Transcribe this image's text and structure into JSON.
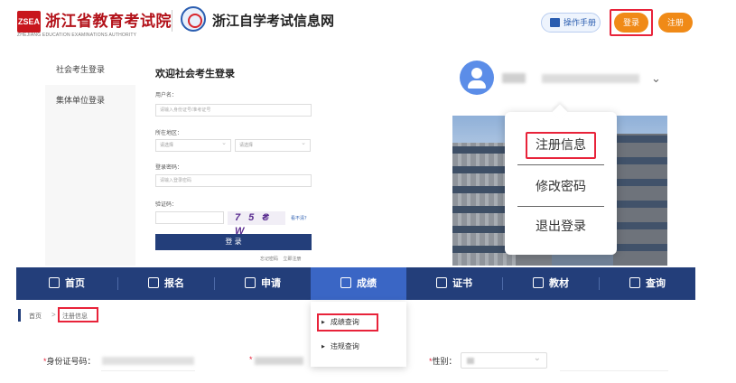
{
  "header": {
    "logo_badge": "ZSEA",
    "logo_title": "浙江省教育考试院",
    "logo_subtitle": "ZHEJIANG EDUCATION EXAMINATIONS AUTHORITY",
    "site_title": "浙江自学考试信息网",
    "manual_label": "操作手册",
    "login_label": "登录",
    "register_label": "注册"
  },
  "login_panel": {
    "tabs": [
      {
        "label": "社会考生登录"
      },
      {
        "label": "集体单位登录"
      }
    ],
    "title": "欢迎社会考生登录",
    "username_label": "用户名：",
    "username_placeholder": "请输入身份证号/准考证号",
    "region_label": "所在地区：",
    "region_select_1": "请选择",
    "region_select_2": "请选择",
    "password_label": "登录密码：",
    "password_placeholder": "请输入登录密码",
    "captcha_label": "验证码：",
    "captcha_text": "7 5 ₴ W",
    "captcha_refresh": "看不清？",
    "submit_label": "登 录",
    "links": "忘记密码 立即注册"
  },
  "user_menu": {
    "items": [
      {
        "label": "注册信息"
      },
      {
        "label": "修改密码"
      },
      {
        "label": "退出登录"
      }
    ]
  },
  "nav": {
    "items": [
      {
        "label": "首页",
        "icon": "home-icon"
      },
      {
        "label": "报名",
        "icon": "user-add-icon"
      },
      {
        "label": "申请",
        "icon": "edit-icon"
      },
      {
        "label": "成绩",
        "icon": "report-icon"
      },
      {
        "label": "证书",
        "icon": "certificate-icon"
      },
      {
        "label": "教材",
        "icon": "book-icon"
      },
      {
        "label": "查询",
        "icon": "search-user-icon"
      }
    ],
    "active_index": 3
  },
  "score_menu": {
    "items": [
      {
        "label": "成绩查询"
      },
      {
        "label": "违规查询"
      }
    ]
  },
  "breadcrumb": {
    "home": "首页",
    "separator": ">",
    "current": "注册信息"
  },
  "form": {
    "id_label": "身份证号码：",
    "gender_label": "性别："
  },
  "colors": {
    "accent_orange": "#f08a17",
    "nav_blue": "#233e7a",
    "active_blue": "#3a66c5",
    "highlight_red": "#e8233a",
    "brand_red": "#b3121a"
  }
}
